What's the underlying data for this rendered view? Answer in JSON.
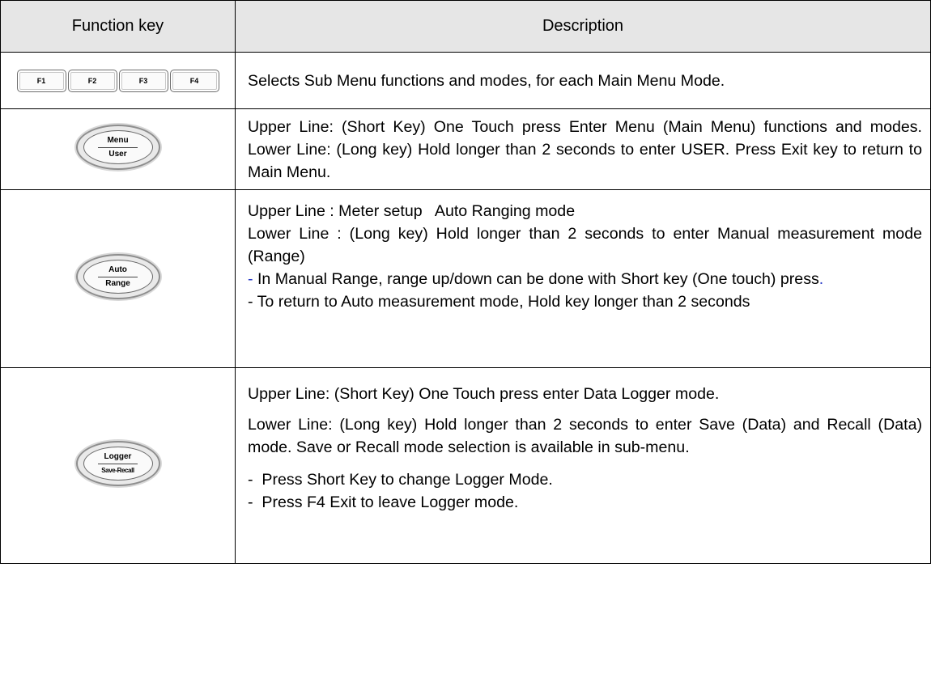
{
  "headers": {
    "function_key": "Function key",
    "description": "Description"
  },
  "fkeys": [
    "F1",
    "F2",
    "F3",
    "F4"
  ],
  "menu_key": {
    "top": "Menu",
    "bottom": "User"
  },
  "auto_key": {
    "top": "Auto",
    "bottom": "Range"
  },
  "logger_key": {
    "top": "Logger",
    "bottom": "Save-Recall"
  },
  "rows": {
    "f_desc": "Selects Sub Menu functions and modes, for each Main Menu Mode.",
    "menu_desc": "Upper Line: (Short Key) One Touch press Enter Menu (Main Menu) functions and modes.   Lower Line: (Long key) Hold longer than 2 seconds to enter USER. Press Exit key to return to Main Menu.",
    "auto_line1": "Upper Line : Meter setup   Auto Ranging mode",
    "auto_line2": "Lower Line : (Long key) Hold longer than 2 seconds to enter Manual measurement mode (Range)",
    "auto_dash_prefix": "-",
    "auto_line3": " In Manual Range, range up/down can be done with Short key (One touch) press",
    "auto_line3_end": ".",
    "auto_line4": "- To return to Auto measurement mode, Hold key longer than 2 seconds",
    "log_line1": "Upper Line: (Short Key) One Touch press enter Data Logger mode.",
    "log_line2": "Lower Line: (Long key) Hold longer than 2 seconds to enter Save (Data) and Recall (Data) mode. Save or Recall mode selection is available in sub-menu.",
    "log_bullets": [
      "Press Short Key to change Logger Mode.",
      "Press F4 Exit to leave Logger mode."
    ]
  },
  "colors": {
    "header_bg": "#e6e6e6",
    "accent_blue": "#2a3cc8"
  }
}
